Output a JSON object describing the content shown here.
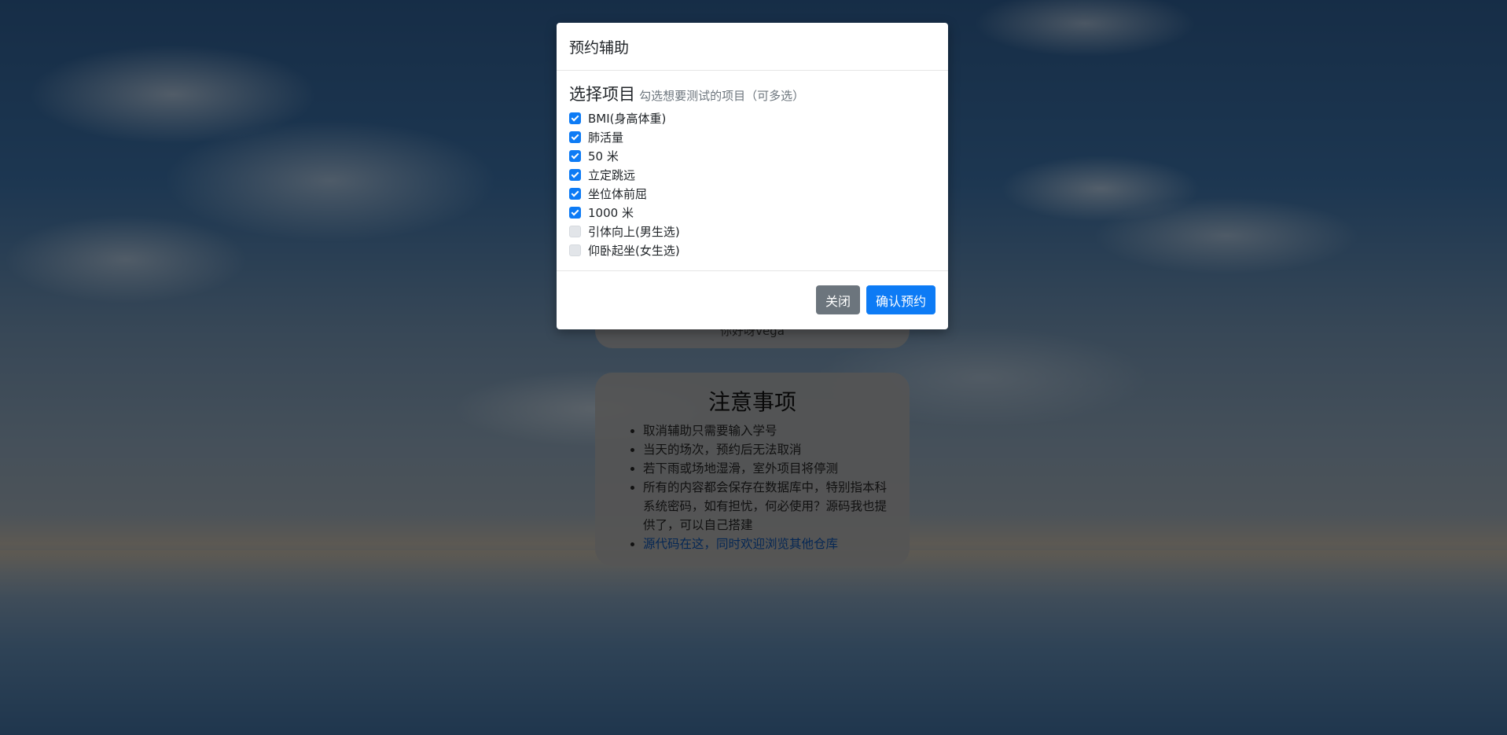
{
  "background": {
    "description_icon": "sky-lake-background"
  },
  "greeting_card": {
    "text": "你好呀vega"
  },
  "notice_card": {
    "title": "注意事项",
    "items": [
      "取消辅助只需要输入学号",
      "当天的场次，预约后无法取消",
      "若下雨或场地湿滑，室外项目将停测",
      "所有的内容都会保存在数据库中，特别指本科系统密码，如有担忧，何必使用？源码我也提供了，可以自己搭建"
    ],
    "link_text": "源代码在这，同时欢迎浏览其他仓库"
  },
  "modal": {
    "title": "预约辅助",
    "section_title": "选择项目",
    "section_hint": "勾选想要测试的项目（可多选）",
    "options": [
      {
        "label": "BMI(身高体重)",
        "checked": true
      },
      {
        "label": "肺活量",
        "checked": true
      },
      {
        "label": "50 米",
        "checked": true
      },
      {
        "label": "立定跳远",
        "checked": true
      },
      {
        "label": "坐位体前屈",
        "checked": true
      },
      {
        "label": "1000 米",
        "checked": true
      },
      {
        "label": "引体向上(男生选)",
        "checked": false
      },
      {
        "label": "仰卧起坐(女生选)",
        "checked": false
      }
    ],
    "close_label": "关闭",
    "confirm_label": "确认预约"
  },
  "colors": {
    "primary": "#0d7bf5",
    "secondary": "#6c757d",
    "link": "#0b4ea8"
  }
}
